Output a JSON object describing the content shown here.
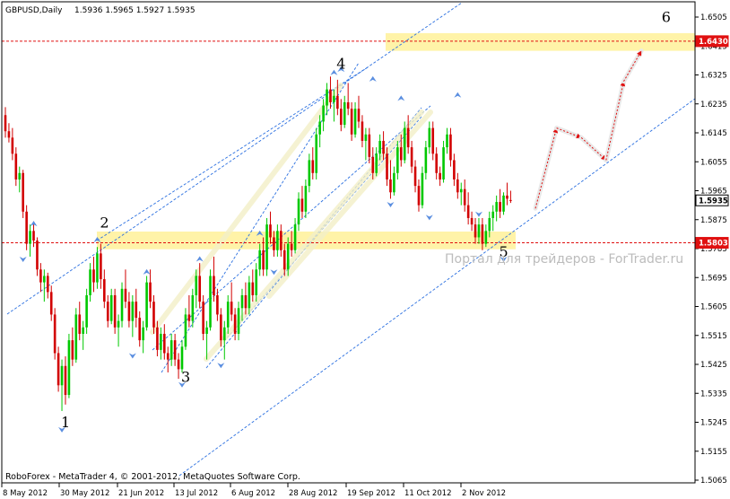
{
  "header": {
    "symbol": "GBPUSD,Daily",
    "ohlc": "1.5936 1.5965 1.5927 1.5935"
  },
  "footer": {
    "copyright": "RoboForex - MetaTrader 4, © 2001-2012, MetaQuotes Software Corp."
  },
  "watermark": "Портал для трейдеров - ForTrader.ru",
  "colors": {
    "bull": "#00c800",
    "bear": "#d20000",
    "zone": "#fff3a8",
    "level_line": "#e01010",
    "channel": "#2a6fe0",
    "forecast": "#e01010",
    "fractal": "#5a8ee0"
  },
  "chart_data": {
    "type": "candlestick",
    "symbol": "GBPUSD",
    "timeframe": "Daily",
    "ylim": [
      1.5065,
      1.6505
    ],
    "y_ticks": [
      "1.6505",
      "1.6415",
      "1.6325",
      "1.6235",
      "1.6145",
      "1.6055",
      "1.5965",
      "1.5875",
      "1.5785",
      "1.5695",
      "1.5605",
      "1.5515",
      "1.5425",
      "1.5335",
      "1.5245",
      "1.5155",
      "1.5065"
    ],
    "x_ticks": [
      "8 May 2012",
      "30 May 2012",
      "21 Jun 2012",
      "13 Jul 2012",
      "6 Aug 2012",
      "28 Aug 2012",
      "19 Sep 2012",
      "11 Oct 2012",
      "2 Nov 2012"
    ],
    "price_labels": [
      {
        "label": "1.6430",
        "value": 1.643
      },
      {
        "label": "1.5935",
        "value": 1.5935
      },
      {
        "label": "1.5803",
        "value": 1.5803
      }
    ],
    "horizontal_levels": [
      1.643,
      1.5803
    ],
    "zones": [
      {
        "from": 1.64,
        "to": 1.6455
      },
      {
        "from": 1.5783,
        "to": 1.5838
      }
    ],
    "wave_labels": [
      {
        "label": "1",
        "bar": 17,
        "price": 1.523
      },
      {
        "label": "2",
        "bar": 28,
        "price": 1.585
      },
      {
        "label": "3",
        "bar": 51,
        "price": 1.537
      },
      {
        "label": "4",
        "bar": 95,
        "price": 1.6345
      },
      {
        "label": "5",
        "bar": 141,
        "price": 1.576
      },
      {
        "label": "6",
        "bar": 187,
        "price": 1.649
      }
    ],
    "candles": [
      [
        1.62,
        1.6225,
        1.613,
        1.615
      ],
      [
        1.615,
        1.6175,
        1.6115,
        1.613
      ],
      [
        1.613,
        1.616,
        1.606,
        1.608
      ],
      [
        1.608,
        1.61,
        1.598,
        1.6
      ],
      [
        1.6,
        1.604,
        1.596,
        1.602
      ],
      [
        1.602,
        1.603,
        1.588,
        1.59
      ],
      [
        1.59,
        1.592,
        1.578,
        1.58
      ],
      [
        1.58,
        1.586,
        1.576,
        1.584
      ],
      [
        1.584,
        1.587,
        1.579,
        1.581
      ],
      [
        1.581,
        1.582,
        1.57,
        1.572
      ],
      [
        1.572,
        1.574,
        1.565,
        1.568
      ],
      [
        1.568,
        1.572,
        1.562,
        1.57
      ],
      [
        1.57,
        1.571,
        1.563,
        1.565
      ],
      [
        1.565,
        1.567,
        1.556,
        1.558
      ],
      [
        1.558,
        1.56,
        1.544,
        1.546
      ],
      [
        1.546,
        1.548,
        1.534,
        1.536
      ],
      [
        1.536,
        1.544,
        1.528,
        1.542
      ],
      [
        1.542,
        1.545,
        1.53,
        1.533
      ],
      [
        1.533,
        1.552,
        1.532,
        1.55
      ],
      [
        1.55,
        1.554,
        1.542,
        1.544
      ],
      [
        1.544,
        1.56,
        1.543,
        1.558
      ],
      [
        1.558,
        1.562,
        1.55,
        1.552
      ],
      [
        1.552,
        1.556,
        1.547,
        1.554
      ],
      [
        1.554,
        1.566,
        1.552,
        1.564
      ],
      [
        1.564,
        1.574,
        1.562,
        1.572
      ],
      [
        1.572,
        1.576,
        1.565,
        1.568
      ],
      [
        1.568,
        1.579,
        1.566,
        1.577
      ],
      [
        1.577,
        1.58,
        1.566,
        1.569
      ],
      [
        1.569,
        1.572,
        1.56,
        1.562
      ],
      [
        1.562,
        1.564,
        1.554,
        1.556
      ],
      [
        1.556,
        1.566,
        1.555,
        1.564
      ],
      [
        1.564,
        1.566,
        1.552,
        1.554
      ],
      [
        1.554,
        1.558,
        1.548,
        1.556
      ],
      [
        1.556,
        1.568,
        1.554,
        1.566
      ],
      [
        1.566,
        1.572,
        1.56,
        1.562
      ],
      [
        1.562,
        1.565,
        1.554,
        1.556
      ],
      [
        1.556,
        1.564,
        1.551,
        1.562
      ],
      [
        1.562,
        1.566,
        1.554,
        1.557
      ],
      [
        1.557,
        1.559,
        1.548,
        1.55
      ],
      [
        1.55,
        1.556,
        1.546,
        1.554
      ],
      [
        1.554,
        1.57,
        1.553,
        1.568
      ],
      [
        1.568,
        1.572,
        1.56,
        1.562
      ],
      [
        1.562,
        1.564,
        1.552,
        1.554
      ],
      [
        1.554,
        1.556,
        1.545,
        1.547
      ],
      [
        1.547,
        1.554,
        1.544,
        1.552
      ],
      [
        1.552,
        1.555,
        1.544,
        1.546
      ],
      [
        1.546,
        1.548,
        1.54,
        1.544
      ],
      [
        1.544,
        1.552,
        1.542,
        1.55
      ],
      [
        1.55,
        1.552,
        1.542,
        1.544
      ],
      [
        1.544,
        1.546,
        1.538,
        1.541
      ],
      [
        1.541,
        1.55,
        1.54,
        1.548
      ],
      [
        1.548,
        1.56,
        1.547,
        1.558
      ],
      [
        1.558,
        1.564,
        1.554,
        1.556
      ],
      [
        1.556,
        1.566,
        1.554,
        1.564
      ],
      [
        1.564,
        1.572,
        1.56,
        1.57
      ],
      [
        1.57,
        1.574,
        1.56,
        1.562
      ],
      [
        1.562,
        1.564,
        1.55,
        1.552
      ],
      [
        1.552,
        1.556,
        1.544,
        1.554
      ],
      [
        1.554,
        1.572,
        1.553,
        1.57
      ],
      [
        1.57,
        1.576,
        1.562,
        1.564
      ],
      [
        1.564,
        1.566,
        1.556,
        1.558
      ],
      [
        1.558,
        1.56,
        1.548,
        1.55
      ],
      [
        1.55,
        1.556,
        1.544,
        1.554
      ],
      [
        1.554,
        1.564,
        1.552,
        1.562
      ],
      [
        1.562,
        1.568,
        1.556,
        1.558
      ],
      [
        1.558,
        1.56,
        1.55,
        1.552
      ],
      [
        1.552,
        1.562,
        1.55,
        1.56
      ],
      [
        1.56,
        1.566,
        1.556,
        1.564
      ],
      [
        1.564,
        1.568,
        1.558,
        1.56
      ],
      [
        1.56,
        1.57,
        1.558,
        1.568
      ],
      [
        1.568,
        1.572,
        1.562,
        1.564
      ],
      [
        1.564,
        1.574,
        1.562,
        1.572
      ],
      [
        1.572,
        1.58,
        1.57,
        1.578
      ],
      [
        1.578,
        1.582,
        1.57,
        1.572
      ],
      [
        1.572,
        1.588,
        1.57,
        1.586
      ],
      [
        1.586,
        1.59,
        1.58,
        1.582
      ],
      [
        1.582,
        1.584,
        1.576,
        1.578
      ],
      [
        1.578,
        1.586,
        1.576,
        1.584
      ],
      [
        1.584,
        1.586,
        1.576,
        1.578
      ],
      [
        1.578,
        1.58,
        1.57,
        1.572
      ],
      [
        1.572,
        1.582,
        1.57,
        1.58
      ],
      [
        1.58,
        1.584,
        1.576,
        1.578
      ],
      [
        1.578,
        1.588,
        1.577,
        1.586
      ],
      [
        1.586,
        1.596,
        1.584,
        1.594
      ],
      [
        1.594,
        1.598,
        1.588,
        1.59
      ],
      [
        1.59,
        1.6,
        1.588,
        1.598
      ],
      [
        1.598,
        1.608,
        1.596,
        1.606
      ],
      [
        1.606,
        1.61,
        1.6,
        1.602
      ],
      [
        1.602,
        1.616,
        1.6,
        1.614
      ],
      [
        1.614,
        1.62,
        1.61,
        1.618
      ],
      [
        1.618,
        1.625,
        1.615,
        1.623
      ],
      [
        1.623,
        1.63,
        1.62,
        1.628
      ],
      [
        1.628,
        1.632,
        1.622,
        1.624
      ],
      [
        1.624,
        1.628,
        1.618,
        1.626
      ],
      [
        1.626,
        1.631,
        1.62,
        1.622
      ],
      [
        1.622,
        1.625,
        1.615,
        1.617
      ],
      [
        1.617,
        1.626,
        1.616,
        1.624
      ],
      [
        1.624,
        1.63,
        1.62,
        1.622
      ],
      [
        1.622,
        1.624,
        1.612,
        1.614
      ],
      [
        1.614,
        1.624,
        1.613,
        1.622
      ],
      [
        1.622,
        1.626,
        1.616,
        1.618
      ],
      [
        1.618,
        1.62,
        1.61,
        1.612
      ],
      [
        1.612,
        1.616,
        1.606,
        1.614
      ],
      [
        1.614,
        1.616,
        1.605,
        1.607
      ],
      [
        1.607,
        1.61,
        1.6,
        1.602
      ],
      [
        1.602,
        1.61,
        1.601,
        1.608
      ],
      [
        1.608,
        1.614,
        1.606,
        1.612
      ],
      [
        1.612,
        1.615,
        1.606,
        1.608
      ],
      [
        1.608,
        1.61,
        1.598,
        1.6
      ],
      [
        1.6,
        1.606,
        1.594,
        1.596
      ],
      [
        1.596,
        1.604,
        1.595,
        1.602
      ],
      [
        1.602,
        1.612,
        1.6,
        1.61
      ],
      [
        1.61,
        1.614,
        1.604,
        1.606
      ],
      [
        1.606,
        1.618,
        1.605,
        1.616
      ],
      [
        1.616,
        1.62,
        1.608,
        1.61
      ],
      [
        1.61,
        1.612,
        1.602,
        1.604
      ],
      [
        1.604,
        1.606,
        1.596,
        1.598
      ],
      [
        1.598,
        1.6,
        1.59,
        1.592
      ],
      [
        1.592,
        1.604,
        1.591,
        1.602
      ],
      [
        1.602,
        1.612,
        1.6,
        1.61
      ],
      [
        1.61,
        1.618,
        1.608,
        1.616
      ],
      [
        1.616,
        1.618,
        1.606,
        1.608
      ],
      [
        1.608,
        1.61,
        1.6,
        1.602
      ],
      [
        1.602,
        1.604,
        1.598,
        1.6
      ],
      [
        1.6,
        1.612,
        1.599,
        1.61
      ],
      [
        1.61,
        1.616,
        1.608,
        1.614
      ],
      [
        1.614,
        1.616,
        1.604,
        1.606
      ],
      [
        1.606,
        1.608,
        1.598,
        1.6
      ],
      [
        1.6,
        1.602,
        1.594,
        1.596
      ],
      [
        1.596,
        1.599,
        1.592,
        1.597
      ],
      [
        1.597,
        1.6,
        1.59,
        1.592
      ],
      [
        1.592,
        1.596,
        1.586,
        1.588
      ],
      [
        1.588,
        1.59,
        1.584,
        1.586
      ],
      [
        1.586,
        1.588,
        1.58,
        1.582
      ],
      [
        1.582,
        1.588,
        1.58,
        1.586
      ],
      [
        1.586,
        1.588,
        1.578,
        1.58
      ],
      [
        1.58,
        1.586,
        1.579,
        1.584
      ],
      [
        1.584,
        1.59,
        1.582,
        1.588
      ],
      [
        1.588,
        1.592,
        1.584,
        1.59
      ],
      [
        1.59,
        1.595,
        1.587,
        1.593
      ],
      [
        1.593,
        1.597,
        1.588,
        1.59
      ],
      [
        1.59,
        1.596,
        1.589,
        1.595
      ],
      [
        1.595,
        1.599,
        1.592,
        1.594
      ],
      [
        1.5936,
        1.5965,
        1.5927,
        1.5935
      ]
    ],
    "fractal_highs": [
      [
        8,
        1.586
      ],
      [
        26,
        1.581
      ],
      [
        40,
        1.571
      ],
      [
        55,
        1.575
      ],
      [
        72,
        1.583
      ],
      [
        93,
        1.633
      ],
      [
        95,
        1.634
      ],
      [
        104,
        1.631
      ],
      [
        112,
        1.625
      ],
      [
        128,
        1.626
      ]
    ],
    "fractal_lows": [
      [
        5,
        1.576
      ],
      [
        16,
        1.523
      ],
      [
        36,
        1.546
      ],
      [
        50,
        1.537
      ],
      [
        61,
        1.543
      ],
      [
        76,
        1.572
      ],
      [
        109,
        1.593
      ],
      [
        120,
        1.589
      ],
      [
        134,
        1.59
      ],
      [
        141,
        1.576
      ]
    ],
    "forecast_path": [
      [
        150,
        1.591
      ],
      [
        156,
        1.616
      ],
      [
        163,
        1.613
      ],
      [
        170,
        1.606
      ],
      [
        175,
        1.6305
      ],
      [
        180,
        1.64
      ]
    ]
  }
}
